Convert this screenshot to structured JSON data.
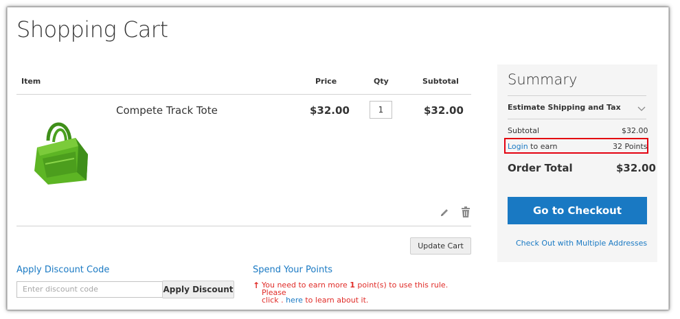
{
  "page": {
    "title": "Shopping Cart"
  },
  "table": {
    "headers": {
      "item": "Item",
      "price": "Price",
      "qty": "Qty",
      "subtotal": "Subtotal"
    },
    "rows": [
      {
        "name": "Compete Track Tote",
        "price": "$32.00",
        "qty": "1",
        "subtotal": "$32.00"
      }
    ],
    "row_icons": [
      "edit-pencil-icon",
      "trash-icon"
    ]
  },
  "actions": {
    "update_cart": "Update Cart"
  },
  "discount": {
    "heading": "Apply Discount Code",
    "placeholder": "Enter discount code",
    "button": "Apply Discount"
  },
  "points": {
    "heading": "Spend Your Points",
    "message_pre": "You need to earn more ",
    "message_bold": "1",
    "message_mid": " point(s) to use this rule. Please",
    "message_line2_pre": "click . ",
    "message_link": "here",
    "message_line2_post": " to learn about it."
  },
  "summary": {
    "title": "Summary",
    "estimate_label": "Estimate Shipping and Tax",
    "subtotal_label": "Subtotal",
    "subtotal_value": "$32.00",
    "login_link": "Login",
    "login_suffix": " to earn",
    "points_value": "32 Points",
    "order_total_label": "Order Total",
    "order_total_value": "$32.00",
    "checkout_button": "Go to Checkout",
    "multi_address_link": "Check Out with Multiple Addresses"
  },
  "colors": {
    "link": "#1979c3",
    "checkout_bg": "#1979c3",
    "warning": "#e02b27",
    "highlight_border": "#e3000f",
    "summary_bg": "#f5f5f5",
    "product_green": "#5db524"
  }
}
